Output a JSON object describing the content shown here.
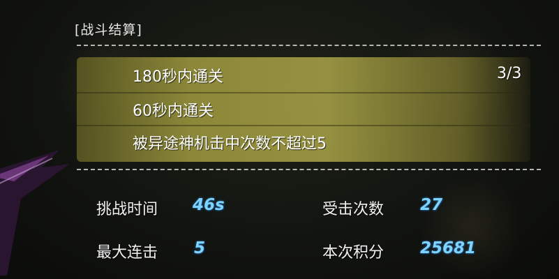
{
  "result_panel": {
    "title": "[战斗结算]",
    "conditions": [
      {
        "text": "180秒内通关"
      },
      {
        "text": "60秒内通关"
      },
      {
        "text": "被异途神机击中次数不超过5"
      }
    ],
    "progress": "3/3"
  },
  "stats": {
    "challenge_time": {
      "label": "挑战时间",
      "value": "46s"
    },
    "hits_taken": {
      "label": "受击次数",
      "value": "27"
    },
    "max_combo": {
      "label": "最大连击",
      "value": "5"
    },
    "score": {
      "label": "本次积分",
      "value": "25681"
    }
  },
  "colors": {
    "stat_value": "#7fd3ff",
    "condition_band": "#9a9540",
    "background": "#121410"
  }
}
